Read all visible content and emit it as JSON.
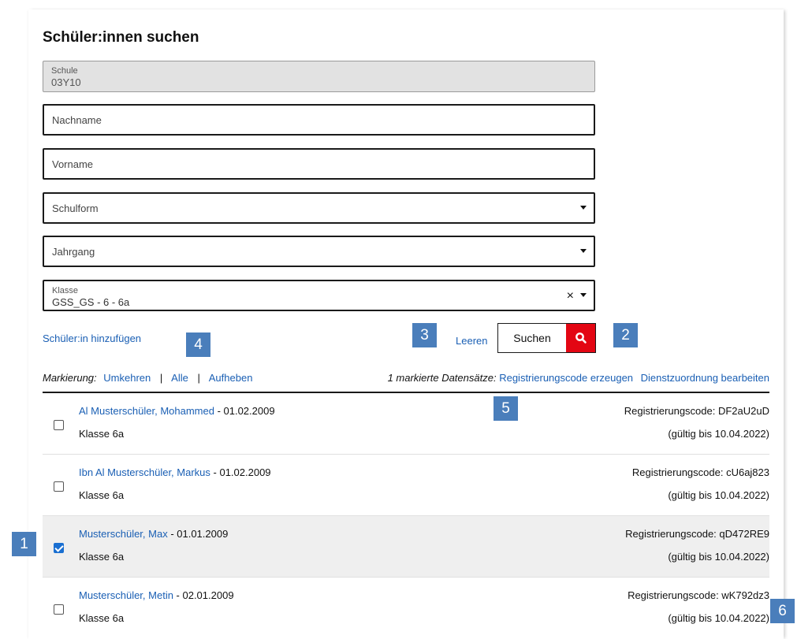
{
  "page": {
    "title": "Schüler:innen suchen"
  },
  "form": {
    "schule": {
      "label": "Schule",
      "value": "03Y10"
    },
    "nachname": {
      "placeholder": "Nachname"
    },
    "vorname": {
      "placeholder": "Vorname"
    },
    "schulform": {
      "placeholder": "Schulform"
    },
    "jahrgang": {
      "placeholder": "Jahrgang"
    },
    "klasse": {
      "label": "Klasse",
      "value": "GSS_GS - 6 - 6a"
    }
  },
  "actions": {
    "add_student": "Schüler:in hinzufügen",
    "clear": "Leeren",
    "search": "Suchen"
  },
  "marking": {
    "label": "Markierung:",
    "invert": "Umkehren",
    "all": "Alle",
    "remove": "Aufheben",
    "separator": "|",
    "count_text": "1 markierte Datensätze:",
    "generate_code": "Registrierungscode erzeugen",
    "edit_assignment": "Dienstzuordnung bearbeiten"
  },
  "students": [
    {
      "name": "Al Musterschüler, Mohammed",
      "birth": " - 01.02.2009",
      "class": "Klasse 6a",
      "code": "Registrierungscode: DF2aU2uD",
      "valid": "(gültig bis 10.04.2022)",
      "checked": false
    },
    {
      "name": "Ibn Al Musterschüler, Markus",
      "birth": " - 01.02.2009",
      "class": "Klasse 6a",
      "code": "Registrierungscode: cU6aj823",
      "valid": "(gültig bis 10.04.2022)",
      "checked": false
    },
    {
      "name": "Musterschüler, Max",
      "birth": " - 01.01.2009",
      "class": "Klasse 6a",
      "code": "Registrierungscode: qD472RE9",
      "valid": "(gültig bis 10.04.2022)",
      "checked": true
    },
    {
      "name": "Musterschüler, Metin",
      "birth": " - 02.01.2009",
      "class": "Klasse 6a",
      "code": "Registrierungscode: wK792dz3",
      "valid": "(gültig bis 10.04.2022)",
      "checked": false
    }
  ],
  "callouts": [
    "1",
    "2",
    "3",
    "4",
    "5",
    "6"
  ],
  "colors": {
    "link": "#1a5fb4",
    "search_red": "#e30613",
    "callout_blue": "#4a7ebb",
    "checkbox_blue": "#1a6fd1"
  },
  "icons": {
    "search": "search-icon",
    "dropdown": "chevron-down-icon",
    "clear": "close-icon",
    "checkbox": "checkbox"
  }
}
